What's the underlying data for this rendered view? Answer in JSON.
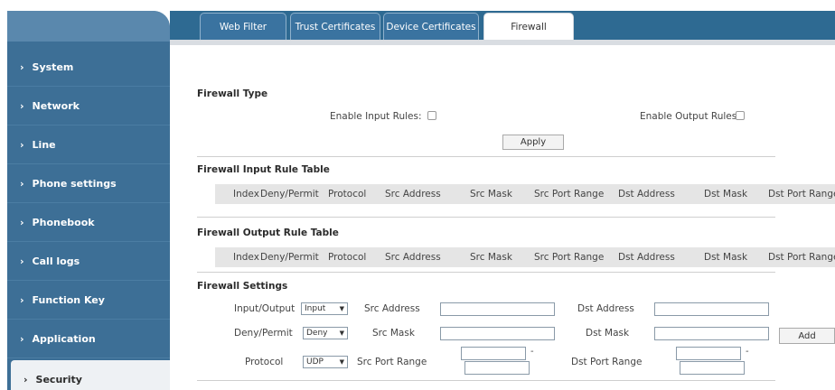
{
  "sidebar": {
    "items": [
      {
        "label": "System"
      },
      {
        "label": "Network"
      },
      {
        "label": "Line"
      },
      {
        "label": "Phone settings"
      },
      {
        "label": "Phonebook"
      },
      {
        "label": "Call logs"
      },
      {
        "label": "Function Key"
      },
      {
        "label": "Application"
      },
      {
        "label": "Security"
      }
    ],
    "chevron": "›",
    "active_index": 8
  },
  "tabs": [
    {
      "label": "Web Filter"
    },
    {
      "label": "Trust Certificates"
    },
    {
      "label": "Device Certificates"
    },
    {
      "label": "Firewall"
    }
  ],
  "firewall_type": {
    "title": "Firewall Type",
    "enable_input_label": "Enable Input Rules:",
    "enable_output_label": "Enable Output Rules:",
    "apply_label": "Apply"
  },
  "input_table": {
    "title": "Firewall Input Rule Table",
    "headers": [
      "Index",
      "Deny/Permit",
      "Protocol",
      "Src Address",
      "Src Mask",
      "Src Port Range",
      "Dst Address",
      "Dst Mask",
      "Dst Port Range"
    ]
  },
  "output_table": {
    "title": "Firewall Output Rule Table",
    "headers": [
      "Index",
      "Deny/Permit",
      "Protocol",
      "Src Address",
      "Src Mask",
      "Src Port Range",
      "Dst Address",
      "Dst Mask",
      "Dst Port Range"
    ]
  },
  "settings": {
    "title": "Firewall Settings",
    "io_label": "Input/Output",
    "io_value": "Input",
    "deny_permit_label": "Deny/Permit",
    "deny_permit_value": "Deny",
    "protocol_label": "Protocol",
    "protocol_value": "UDP",
    "src_address_label": "Src Address",
    "src_mask_label": "Src Mask",
    "src_port_range_label": "Src Port Range",
    "dst_address_label": "Dst Address",
    "dst_mask_label": "Dst Mask",
    "dst_port_range_label": "Dst Port Range",
    "add_label": "Add",
    "range_separator": "-"
  },
  "colors": {
    "sidebar_bg": "#3d6f96",
    "tabbar_bg": "#2e6a92",
    "active_item_bg": "#eef1f4"
  }
}
